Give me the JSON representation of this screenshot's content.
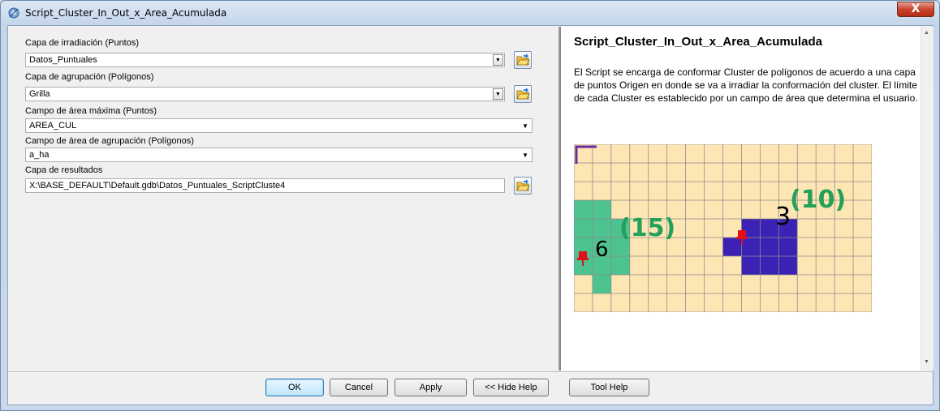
{
  "window": {
    "title": "Script_Cluster_In_Out_x_Area_Acumulada",
    "close_label": "X"
  },
  "params": [
    {
      "label": "Capa de irradiación (Puntos)",
      "value": "Datos_Puntuales"
    },
    {
      "label": "Capa de agrupación  (Polígonos)",
      "value": "Grilla"
    },
    {
      "label": "Campo de área máxima (Puntos)",
      "value": "AREA_CUL"
    },
    {
      "label": "Campo de área de agrupación (Polígonos)",
      "value": "a_ha"
    },
    {
      "label": "Capa de resultados",
      "value": "X:\\BASE_DEFAULT\\Default.gdb\\Datos_Puntuales_ScriptCluste4"
    }
  ],
  "help": {
    "title": "Script_Cluster_In_Out_x_Area_Acumulada",
    "description": "El Script se encarga de conformar Cluster de polígonos de acuerdo a una capa de puntos Origen en donde se va a irradiar la conformación del cluster. El límite de cada Cluster es establecido por un campo de área que determina el usuario.",
    "figure": {
      "cluster1": {
        "count": "6",
        "area": "(15)"
      },
      "cluster2": {
        "count": "3",
        "area": "(10)"
      }
    }
  },
  "buttons": {
    "ok": "OK",
    "cancel": "Cancel",
    "apply": "Apply",
    "hide_help": "<< Hide Help",
    "tool_help": "Tool Help"
  },
  "colors": {
    "grid_fill": "#fde6b4",
    "grid_line": "#8c8c8c",
    "cluster1_fill": "#4dc38f",
    "cluster2_fill": "#3b22b4",
    "area_label": "#23a05a",
    "pin": "#e0101a"
  },
  "icons": {
    "app": "script-gear-icon",
    "folder": "open-folder-icon",
    "pin": "push-pin-icon"
  }
}
